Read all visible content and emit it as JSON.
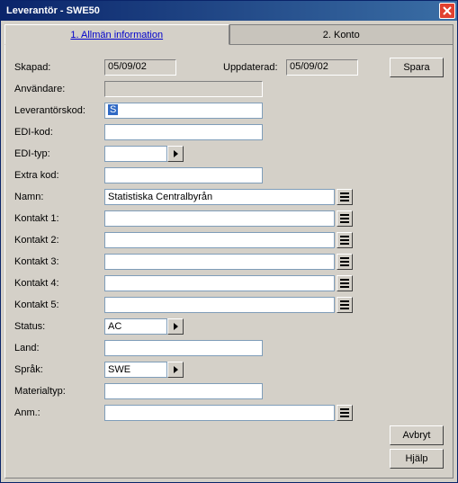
{
  "window": {
    "title": "Leverantör - SWE50"
  },
  "tabs": {
    "t1": "1. Allmän information",
    "t2": "2. Konto"
  },
  "labels": {
    "skapad": "Skapad:",
    "uppdaterad": "Uppdaterad:",
    "anvandare": "Användare:",
    "leverantorskod": "Leverantörskod:",
    "edikod": "EDI-kod:",
    "edityp": "EDI-typ:",
    "extrakod": "Extra kod:",
    "namn": "Namn:",
    "kontakt1": "Kontakt 1:",
    "kontakt2": "Kontakt 2:",
    "kontakt3": "Kontakt 3:",
    "kontakt4": "Kontakt 4:",
    "kontakt5": "Kontakt 5:",
    "status": "Status:",
    "land": "Land:",
    "sprak": "Språk:",
    "materialtyp": "Materialtyp:",
    "anm": "Anm.:"
  },
  "values": {
    "skapad": "05/09/02",
    "uppdaterad": "05/09/02",
    "anvandare": "",
    "leverantorskod": "S",
    "edikod": "",
    "edityp": "",
    "extrakod": "",
    "namn": "Statistiska Centralbyrån",
    "kontakt1": "",
    "kontakt2": "",
    "kontakt3": "",
    "kontakt4": "",
    "kontakt5": "",
    "status": "AC",
    "land": "",
    "sprak": "SWE",
    "materialtyp": "",
    "anm": ""
  },
  "buttons": {
    "spara": "Spara",
    "avbryt": "Avbryt",
    "hjalp": "Hjälp"
  }
}
